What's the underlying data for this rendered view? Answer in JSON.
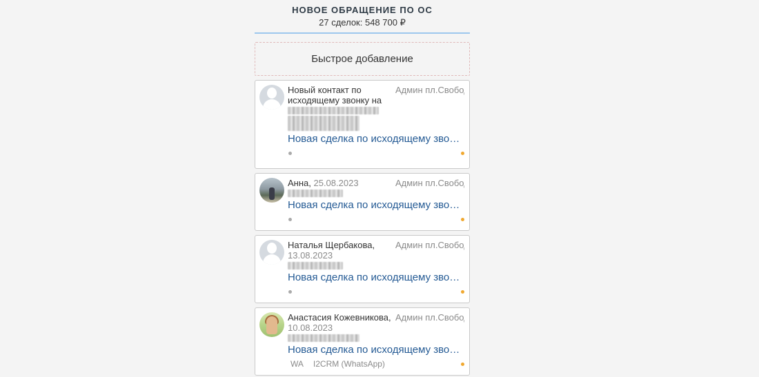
{
  "column": {
    "title": "НОВОЕ ОБРАЩЕНИЕ ПО ОС",
    "summary": "27 сделок: 548 700 ₽",
    "quick_add": "Быстрое добавление"
  },
  "cards": [
    {
      "name": "Новый контакт по исходящему звонку на",
      "date": "",
      "responsible": "Админ пл.Свободы",
      "deal": "Новая сделка по исходящему звонку",
      "avatar": "user-placeholder-icon"
    },
    {
      "name": "Анна, ",
      "date": "25.08.2023",
      "responsible": "Админ пл.Свободы",
      "deal": "Новая сделка по исходящему звонку",
      "avatar": "photo"
    },
    {
      "name": "Наталья Щербакова, ",
      "date": "13.08.2023",
      "responsible": "Админ пл.Свободы",
      "deal": "Новая сделка по исходящему звонку",
      "avatar": "user-placeholder-icon"
    },
    {
      "name": "Анастасия Кожевникова, ",
      "date": "10.08.2023",
      "responsible": "Админ пл.Свободы",
      "deal": "Новая сделка по исходящему звонку",
      "avatar": "photo",
      "source_tag": "WA",
      "source_name": "I2CRM (WhatsApp)"
    }
  ],
  "colors": {
    "deal_link": "#245a94",
    "header_underline": "#9cc7ee",
    "task_dot": "#f0a830"
  }
}
